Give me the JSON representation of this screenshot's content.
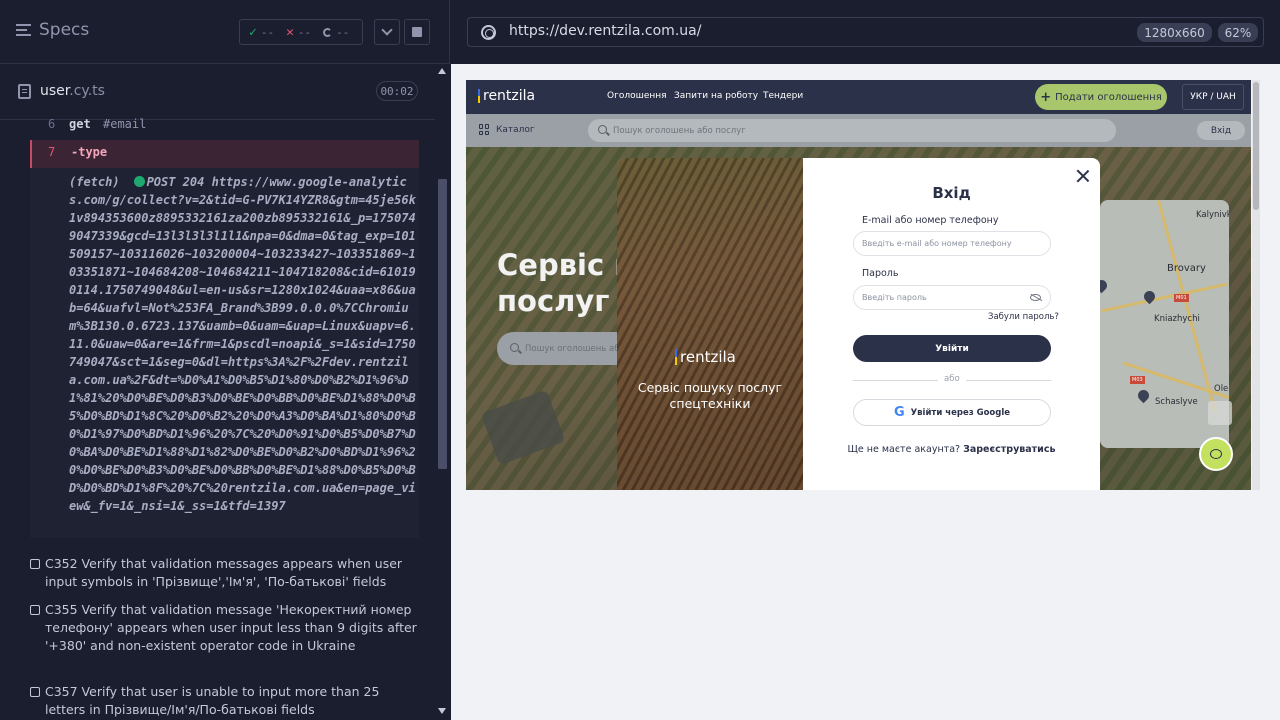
{
  "reporter": {
    "header": {
      "specs_label": "Specs"
    },
    "stats": {
      "passed": "--",
      "failed": "--",
      "pending": "--"
    },
    "file": {
      "name": "user",
      "ext": ".cy.ts",
      "duration": "00:02"
    },
    "commands": [
      {
        "num": "6",
        "name": "get",
        "arg": "#email"
      },
      {
        "num": "7",
        "name": "-type",
        "arg": ""
      }
    ],
    "log": {
      "prefix": "(fetch)",
      "text": "POST 204 https://www.google-analytics.com/g/collect?v=2&tid=G-PV7K14YZR8&gtm=45je56k1v894353600z8895332161za200zb895332161&_p=1750749047339&gcd=13l3l3l3l1l1&npa=0&dma=0&tag_exp=101509157~103116026~103200004~103233427~103351869~103351871~104684208~104684211~104718208&cid=610190114.1750749048&ul=en-us&sr=1280x1024&uaa=x86&uab=64&uafvl=Not%253FA_Brand%3B99.0.0.0%7CChromium%3B130.0.6723.137&uamb=0&uam=&uap=Linux&uapv=6.11.0&uaw=0&are=1&frm=1&pscdl=noapi&_s=1&sid=1750749047&sct=1&seg=0&dl=https%3A%2F%2Fdev.rentzila.com.ua%2F&dt=%D0%A1%D0%B5%D1%80%D0%B2%D1%96%D1%81%20%D0%BE%D0%B3%D0%BE%D0%BB%D0%BE%D1%88%D0%B5%D0%BD%D1%8C%20%D0%B2%20%D0%A3%D0%BA%D1%80%D0%B0%D1%97%D0%BD%D1%96%20%7C%20%D0%91%D0%B5%D0%B7%D0%BA%D0%BE%D1%88%D1%82%D0%BE%D0%B2%D0%BD%D1%96%20%D0%BE%D0%B3%D0%BE%D0%BB%D0%BE%D1%88%D0%B5%D0%BD%D0%BD%D1%8F%20%7C%20rentzila.com.ua&en=page_view&_fv=1&_nsi=1&_ss=1&tfd=1397"
    },
    "tests": [
      {
        "label": "C352 Verify that validation messages appears when user input symbols in 'Прізвище','Ім'я', 'По-батькові' fields"
      },
      {
        "label": "C355 Verify that validation message 'Некоректний номер телефону' appears when user input less than 9 digits after '+380' and non-existent operator code in Ukraine"
      },
      {
        "label": "C357 Verify that user is unable to input more than 25 letters in Прізвище/Ім'я/По-батькові fields"
      }
    ]
  },
  "aut": {
    "url": "https://dev.rentzila.com.ua/",
    "viewport": "1280x660",
    "zoom": "62%"
  },
  "site": {
    "brand": "rentzila",
    "nav": [
      "Оголошення",
      "Запити на роботу",
      "Тендери"
    ],
    "submit_label": "Подати оголошення",
    "lang_label": "УКР / UAH",
    "catalog_label": "Каталог",
    "search_placeholder": "Пошук оголошень або послуг",
    "login_label": "Вхід",
    "hero_title": "Сервіс п\nпослуг с",
    "hero_search_placeholder": "Пошук оголошень або",
    "map_labels": [
      "Kalynivka",
      "Brovary",
      "Kniazhychi",
      "Schaslyve",
      "Oleks",
      "M01",
      "M03"
    ]
  },
  "modal": {
    "brand": "rentzila",
    "tagline": "Сервіс пошуку послуг спецтехніки",
    "title": "Вхід",
    "email_label": "E-mail або номер телефону",
    "email_placeholder": "Введіть e-mail або номер телефону",
    "password_label": "Пароль",
    "password_placeholder": "Введіть пароль",
    "forgot_label": "Забули пароль?",
    "submit_label": "Увійти",
    "or_label": "або",
    "google_label": "Увійти через Google",
    "no_account": "Ще не маєте акаунта?",
    "register_label": "Зареєструватись"
  }
}
